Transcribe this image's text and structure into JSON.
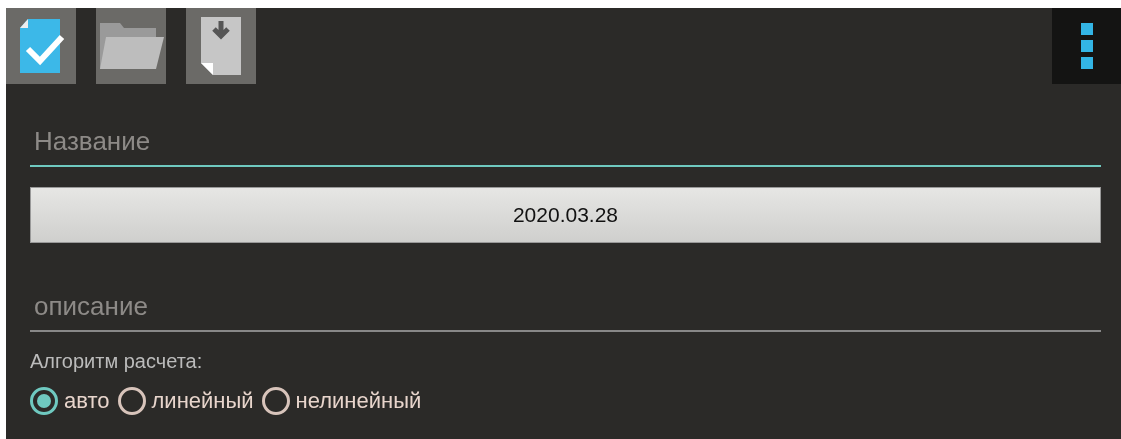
{
  "toolbar": {
    "actions": [
      {
        "kind": "save"
      },
      {
        "kind": "open"
      },
      {
        "kind": "import"
      }
    ],
    "overflow_menu": {
      "kind": "menu"
    }
  },
  "fields": [
    {
      "placeholder": "Название",
      "focused": true
    },
    {
      "kind": "date",
      "label": "2020.03.28"
    },
    {
      "placeholder": "описание",
      "focused": false
    }
  ],
  "algorithm": {
    "label": "Алгоритм расчета:",
    "options": [
      {
        "label": "авто",
        "selected": true
      },
      {
        "label": "линейный",
        "selected": false
      },
      {
        "label": "нелинейный",
        "selected": false
      }
    ]
  }
}
